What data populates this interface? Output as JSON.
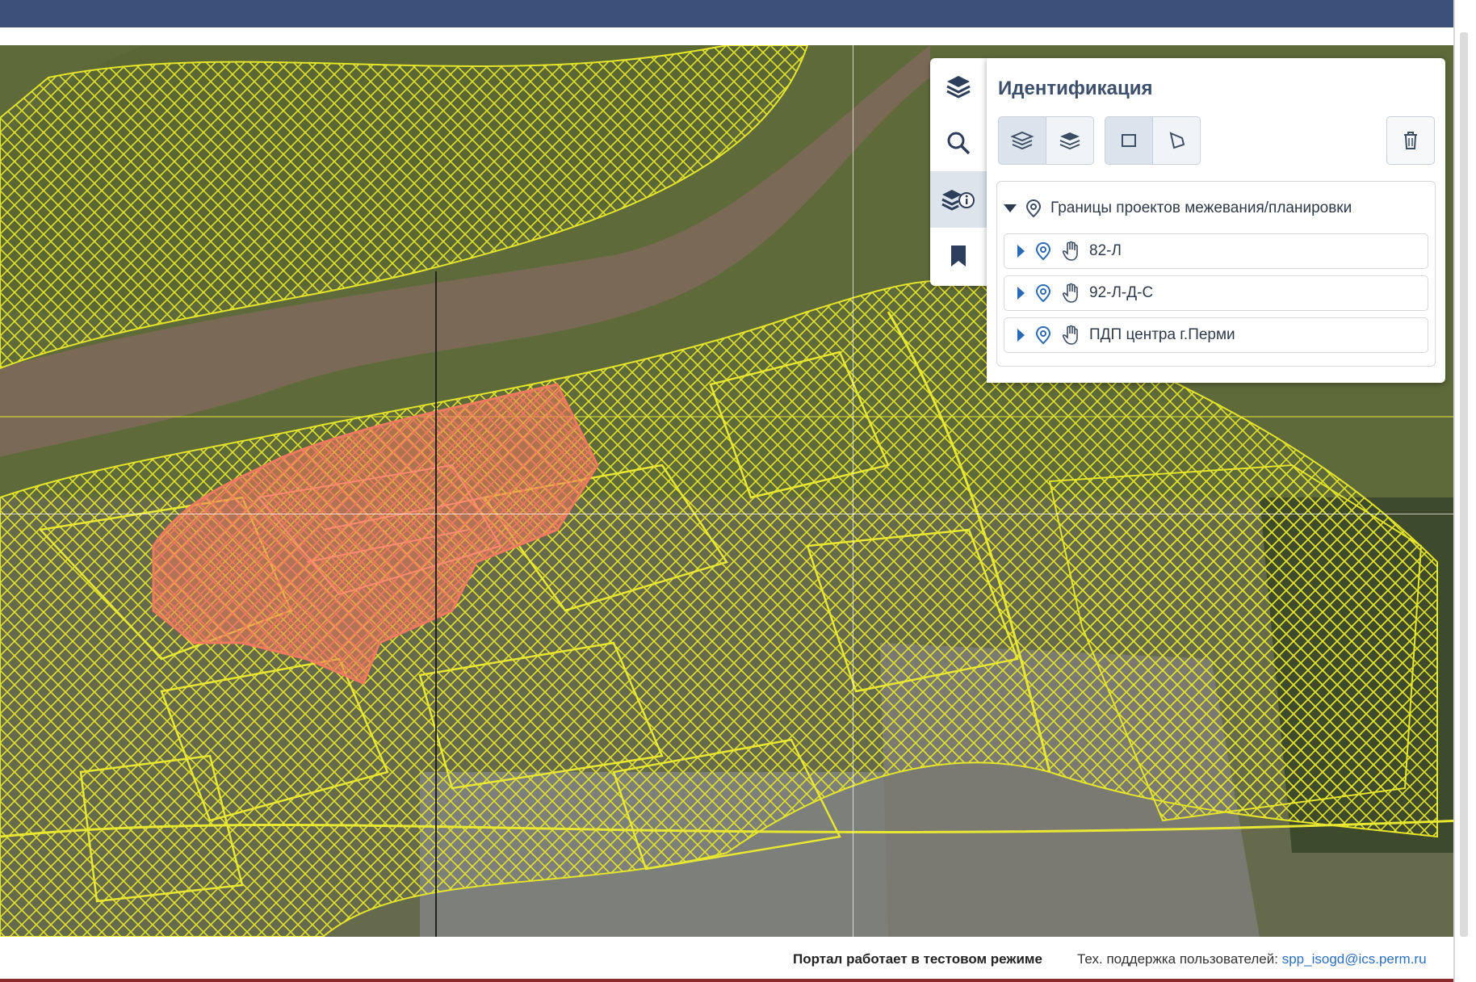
{
  "toolbar": {
    "tools": [
      {
        "icon": "layers-icon"
      },
      {
        "icon": "search-icon"
      },
      {
        "icon": "layers-info-icon",
        "active": true
      },
      {
        "icon": "bookmark-icon"
      }
    ]
  },
  "panel": {
    "title": "Идентификация",
    "mode_buttons": [
      "layers-all-icon",
      "layers-visible-icon"
    ],
    "shape_buttons": [
      "rectangle-icon",
      "polygon-icon"
    ],
    "clear_icon": "trash-icon"
  },
  "tree": {
    "group": {
      "label": "Границы проектов межевания/планировки",
      "icon": "location-pin-icon"
    },
    "items": [
      {
        "label": "82-Л"
      },
      {
        "label": "92-Л-Д-С"
      },
      {
        "label": "ПДП центра г.Перми"
      }
    ]
  },
  "footer": {
    "test_mode": "Портал работает в тестовом режиме",
    "support_label": "Тех. поддержка пользователей:",
    "support_email": "spp_isogd@ics.perm.ru"
  },
  "colors": {
    "header": "#3a5079",
    "overlay_yellow": "#e5e52a",
    "selected_red": "#f2785f",
    "river": "#7a6a55"
  }
}
